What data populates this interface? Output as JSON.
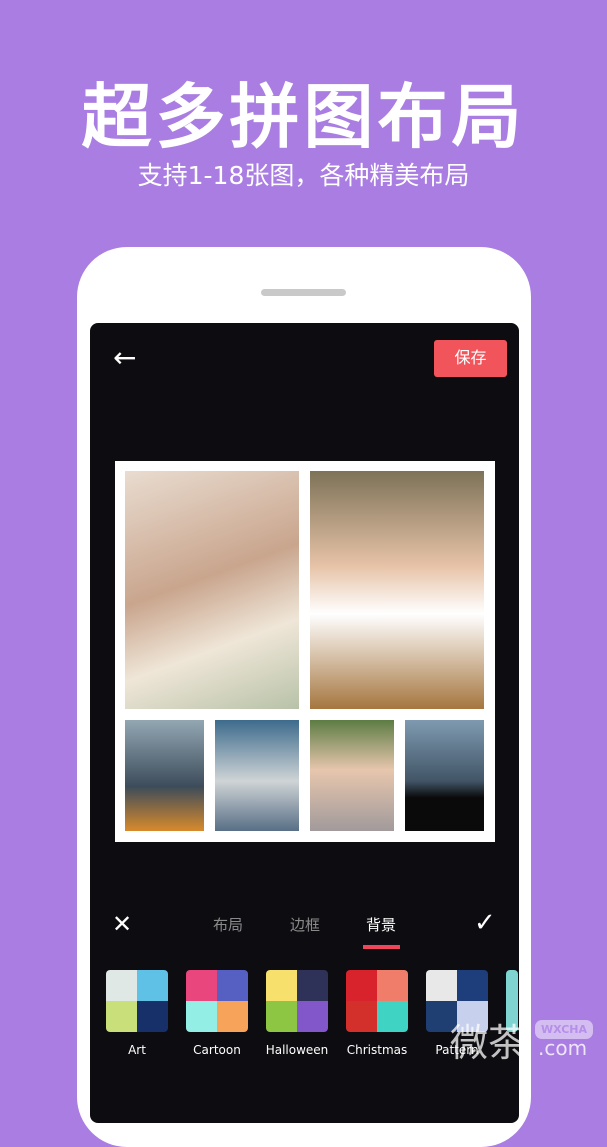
{
  "headline": "超多拼图布局",
  "subheadline": "支持1-18张图，各种精美布局",
  "app": {
    "back_icon": "arrow-left-icon",
    "save_label": "保存",
    "tabs": [
      {
        "label": "布局"
      },
      {
        "label": "边框"
      },
      {
        "label": "背景",
        "active": true
      }
    ],
    "accent": "#f2545b",
    "backgrounds": [
      {
        "label": "Art",
        "colors": [
          "#dfe8e4",
          "#5fc1e6",
          "#c9e07a",
          "#17306a"
        ]
      },
      {
        "label": "Cartoon",
        "colors": [
          "#e8467d",
          "#5660c2",
          "#93eee6",
          "#f7a35a"
        ]
      },
      {
        "label": "Halloween",
        "colors": [
          "#f7e06c",
          "#2e3258",
          "#8dc643",
          "#8157c9"
        ]
      },
      {
        "label": "Christmas",
        "colors": [
          "#d8232d",
          "#f07d6a",
          "#d4302b",
          "#3ed3c2"
        ]
      },
      {
        "label": "Pattern",
        "colors": [
          "#e8e8e8",
          "#1d3d7b",
          "#1f3f72",
          "#c7d0ec"
        ]
      }
    ]
  },
  "watermark": {
    "text": "微茶",
    "badge": "WXCHA",
    "domain": ".com"
  }
}
